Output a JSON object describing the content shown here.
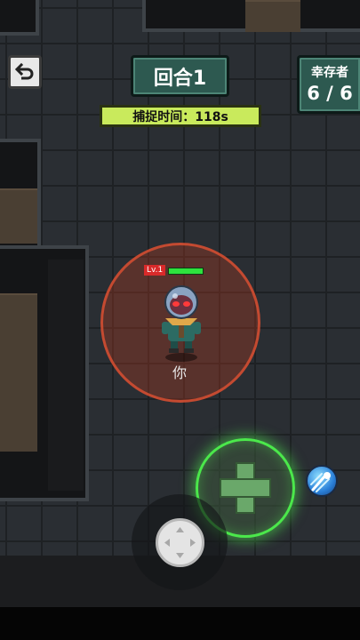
{
  "hud": {
    "round_label": "回合1",
    "timer_text": "捕捉时间：118s",
    "survivors_label": "幸存者",
    "survivors_count": "6 / 6"
  },
  "player": {
    "level": "Lv.1",
    "name": "你",
    "hp_fraction": 1.0
  },
  "icons": {
    "back": "back-arrow-icon",
    "action": "plus-cross-icon",
    "skill": "comet-skill-icon",
    "joystick": "dpad-arrows-icon"
  },
  "colors": {
    "panel_teal": "#2d5950",
    "timer_lime": "#c9ea5c",
    "range_red": "#d75032",
    "action_green": "#4be84b",
    "hp_green": "#2ee23e",
    "level_red": "#d92a2a"
  }
}
